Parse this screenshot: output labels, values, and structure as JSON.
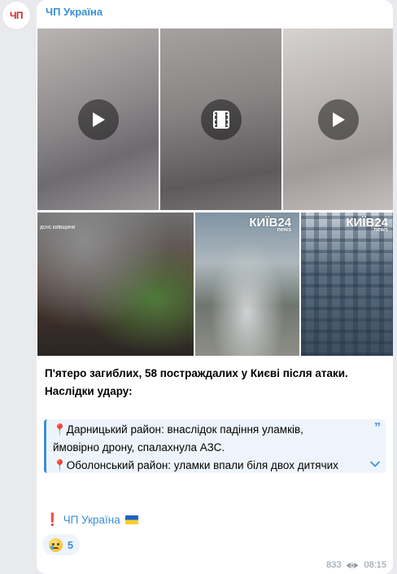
{
  "channel": {
    "avatar_text": "ЧП",
    "name": "ЧП Україна"
  },
  "media": {
    "videos": [
      {
        "icon": "play-icon"
      },
      {
        "icon": "film-icon"
      },
      {
        "icon": "play-icon"
      }
    ],
    "photos": [
      {
        "watermark": "ДСНС КИЇВЩИНИ"
      },
      {
        "watermark": "КИЇВ24",
        "watermark_sub": "news"
      },
      {
        "watermark": "КИЇВ24",
        "watermark_sub": "news"
      }
    ]
  },
  "message": {
    "text_line1": "П'ятеро загиблих, 58 постраждалих у Києві після атаки.",
    "text_line2": "Наслідки удару:",
    "quote_line1": "📍Дарницький район: внаслідок падіння уламків,",
    "quote_line2": "ймовірно дрону, спалахнула АЗС.",
    "quote_line3": "📍Оболонський район: уламки впали біля двох дитячих",
    "signature_mark": "❗",
    "signature": "ЧП Україна"
  },
  "reaction": {
    "emoji": "crying-face",
    "count": "5"
  },
  "footer": {
    "views": "833",
    "time": "08:15"
  },
  "colors": {
    "accent": "#3a8fd8",
    "brand_red": "#d8232a",
    "meta": "#8a96a3"
  }
}
